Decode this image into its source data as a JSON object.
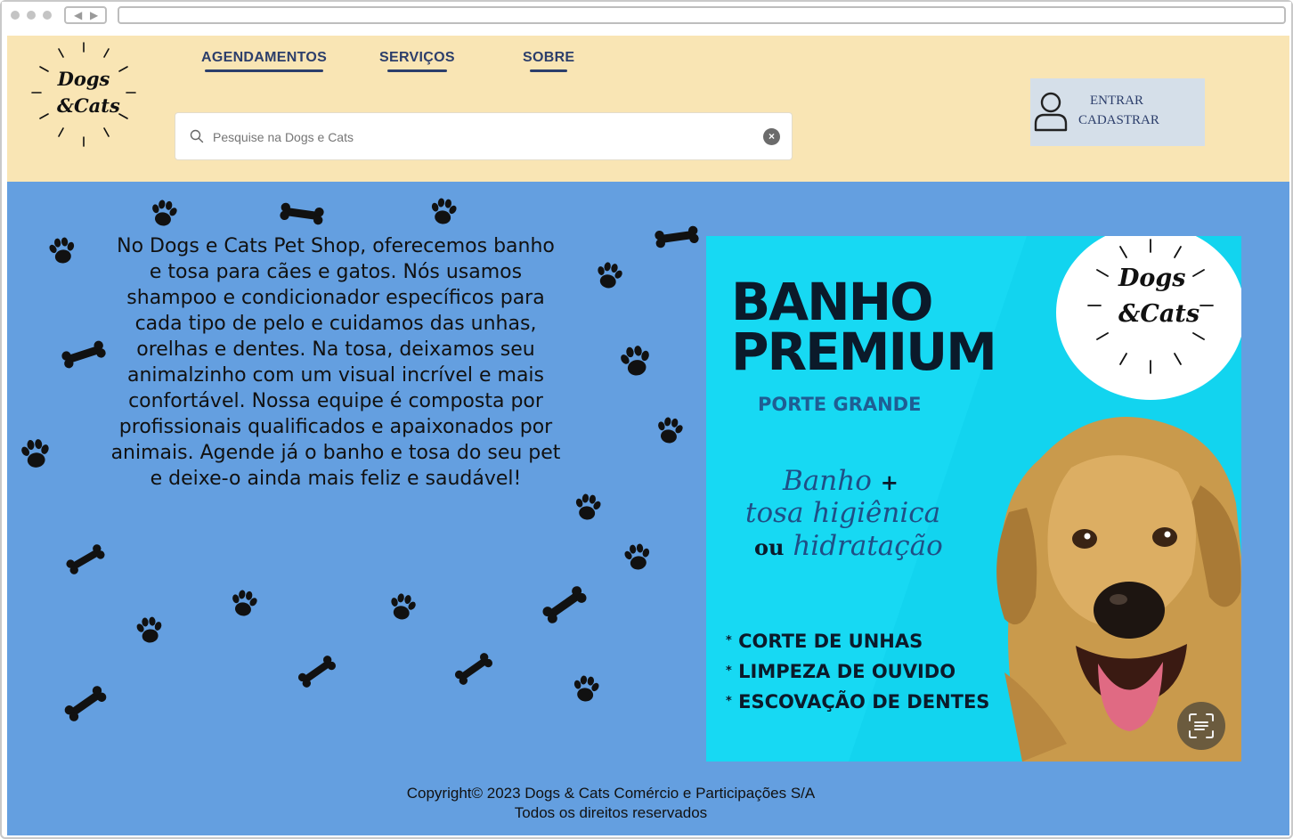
{
  "nav": {
    "agendamentos": "AGENDAMENTOS",
    "servicos": "SERVIÇOS",
    "sobre": "SOBRE"
  },
  "logo": {
    "line1": "Dogs",
    "line2": "&Cats"
  },
  "search": {
    "placeholder": "Pesquise na Dogs e Cats"
  },
  "account": {
    "entrar": "ENTRAR",
    "cadastrar": "CADASTRAR"
  },
  "description": "No Dogs e Cats Pet Shop, oferecemos banho e tosa para cães e gatos. Nós usamos shampoo e condicionador específicos para cada tipo de pelo e cuidamos das unhas, orelhas e dentes. Na tosa, deixamos seu animalzinho com um visual incrível e mais confortável. Nossa equipe é composta por profissionais qualificados e apaixonados por animais. Agende já o banho e tosa do seu pet e deixe-o ainda mais feliz e saudável!",
  "promo": {
    "title_line1": "BANHO",
    "title_line2": "PREMIUM",
    "subtitle": "PORTE GRANDE",
    "script_line1": "Banho",
    "script_plus": "+",
    "script_line2": "tosa higiênica",
    "script_ou": "ou",
    "script_line3": "hidratação",
    "list": [
      "CORTE DE UNHAS",
      "LIMPEZA DE OUVIDO",
      "ESCOVAÇÃO DE DENTES"
    ],
    "badge_line1": "Dogs",
    "badge_line2": "&Cats"
  },
  "footer": {
    "copyright": "Copyright© 2023 Dogs & Cats Comércio e Participações S/A",
    "rights": "Todos os direitos reservados"
  },
  "colors": {
    "header_bg": "#f9e5b4",
    "main_bg": "#649fe0",
    "nav_text": "#2c3e6b",
    "login_bg": "#d5dfe9",
    "promo_bg": "#12d4ef"
  }
}
